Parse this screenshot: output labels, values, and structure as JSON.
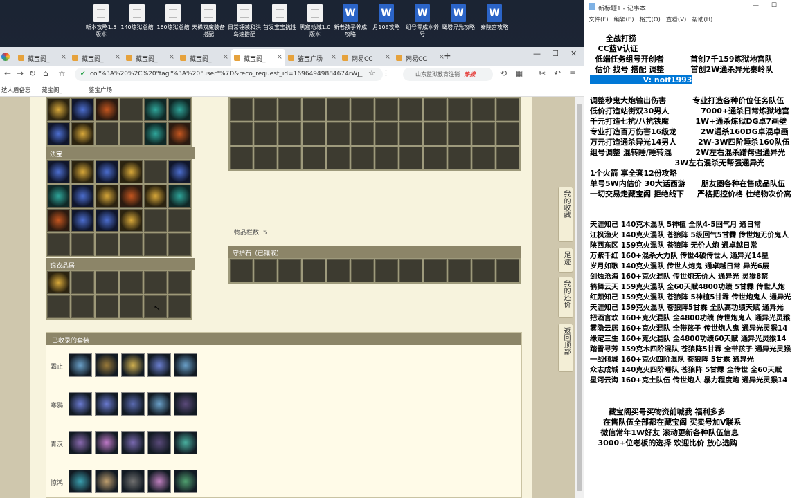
{
  "desktop": {
    "icons": [
      {
        "label": "新本攻略1.5版本",
        "type": "doc"
      },
      {
        "label": "140炼狱总结",
        "type": "doc"
      },
      {
        "label": "160炼狱总结",
        "type": "doc"
      },
      {
        "label": "天梯双魔装备搭配",
        "type": "doc"
      },
      {
        "label": "日常锤装和洪岛速搭配",
        "type": "doc"
      },
      {
        "label": "首发宝宝抗性",
        "type": "doc"
      },
      {
        "label": "黑窟动城1.0版本",
        "type": "doc"
      },
      {
        "label": "新老孩子养成攻略",
        "type": "word"
      },
      {
        "label": "月10E攻略",
        "type": "word"
      },
      {
        "label": "组号零成本养号",
        "type": "word"
      },
      {
        "label": "鹰塔异光攻略",
        "type": "word"
      },
      {
        "label": "秦陵宫攻略",
        "type": "word"
      }
    ]
  },
  "browser": {
    "tabs": [
      "藏宝阁_",
      "藏宝阁_",
      "藏宝阁_",
      "藏宝阁_",
      "藏宝阁_",
      "鉴宝广场",
      "网易CC",
      "网易CC"
    ],
    "active_tab": 4,
    "url": "co\"%3A%20%2C%20\"tag\"%3A%20\"user\"%7D&reco_request_id=16964949884674rWj_",
    "search_text": "山东监狱教育注销",
    "search_badge": "热搜",
    "bookmarks": [
      "达人盾备忘",
      "藏宝阁_",
      "鉴宝广场"
    ]
  },
  "game": {
    "section_fabao": "法宝",
    "section_special": "锦衣品居",
    "item_count_label": "物品栏数: 5",
    "guard_stone_label": "守护石（已镶嵌）",
    "set_panel_title": "已收录的套装",
    "set_rows": [
      "霜止:",
      "寒鸦:",
      "青汉:",
      "惊鸿:"
    ],
    "side_buttons": [
      "我的收藏",
      "足迹",
      "我的还价",
      "返回顶部"
    ]
  },
  "notepad": {
    "title": "新标题1 - 记事本",
    "menu": [
      "文件(F)",
      "编辑(E)",
      "格式(O)",
      "查看(V)",
      "帮助(H)"
    ],
    "lines": [
      "      全战打捞",
      "   CC蓝V认证  ",
      "  低端任务组号开创者          首创7千159炼狱地宫队",
      "  估价 找号 搭配 调整          首创2W通杀异光秦岭队",
      "                    V: noif1993",
      "",
      "调整秒鬼大炮输出伤害          专业打造各种价位任务队伍",
      "低价打造站街双30男人            7000+通杀日常炼狱地宫",
      "千元打造七抗/八抗铁魔          1W+通杀炼狱DG卓7画壁",
      "专业打造百万伤害16级龙         2W通杀160DG卓混卓画",
      "万元打造通杀异光14男人        2W-3W四阶睡杀160队伍",
      "组号调整 混转睡/睡转混         2W左右混杀蹭帮强通异光",
      "                                3W左右混杀无帮强通异光",
      "1个火箭 享全套12份攻略",
      "单号5W内估价 30大话西游      朋友圈各种在售成品队伍",
      "一切交易走藏宝阁 拒绝线下     严格把控价格 杜绝物次价高",
      "",
      "",
      "天涯知己 140克木混队 5神植 全队4-5回气月 通日常",
      "江枫渔火 140克火混队 苍狼阵 5级回气5甘霖 传世炮无价鬼人",
      "陕西东区 159克火混队 苍狼阵 无价人炮 通卓越日常",
      "万紫千红 160+混杀大力队 传世4破传世人 通异光14星",
      "岁月如歌 140克火混队 传世人炮鬼 通卓越日常 异光6层",
      "剑烛沧海 160+克火混队 传世炮无价人 通异光 灵猴8禁",
      "鹤舞云天 159克火混队 全60天赋4800功绩 5甘霖 传世人炮",
      "红颜知己 159克火混队 苍狼阵 5神植5甘霖 传世炮鬼人 通异光",
      "天涯知己 159克火混队 苍狼阵5甘霖 全队高功绩天赋 通异光",
      "把酒言欢 160+克火混队 全4800功绩 传世炮鬼人 通异光灵猴",
      "雾隐云居 160+克火混队 全带孩子 传世炮人鬼 通异光灵猴14",
      "缘定三生 160+克火混队 全4800功绩60天赋 通异光灵猴14",
      "踏雪寻芳 159克木四阶混队 苍狼阵5甘霖 全带孩子 通异光灵猴",
      "一战倾城 160+克火四阶混队 苍狼阵 5甘霖 通异光",
      "众志成城 140克火四阶睡队 苍狼阵 5甘霖 全传世 全60天赋",
      "星河云海 160+克土队伍 传世炮人 暴力程度炮 通异光灵猴14",
      "",
      "",
      "       藏宝阁买号买物资前喊我 福利多多",
      "     在售队伍全部都在藏宝阁 买卖号加V联系",
      "    微信常年1W好友 滚动更新各种队伍信息",
      "   3000+位老板的选择 欢迎比价 放心选购"
    ]
  }
}
